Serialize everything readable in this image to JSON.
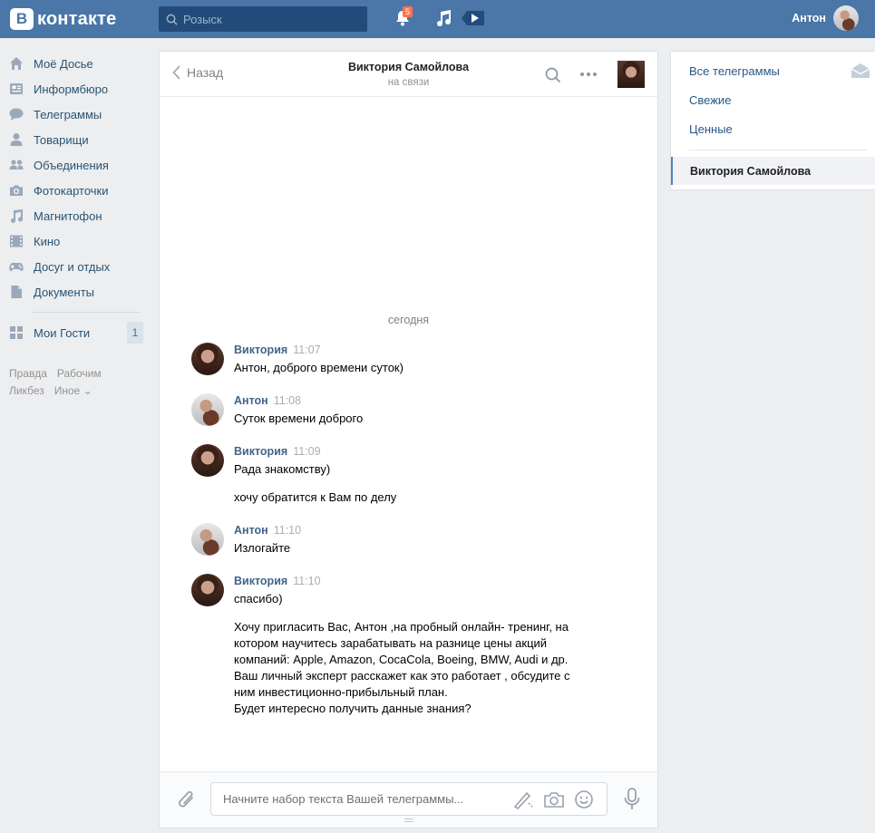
{
  "header": {
    "logo_letter": "В",
    "logo_text": "контакте",
    "search_placeholder": "Розыск",
    "notifications_count": "5",
    "user_name": "Антон"
  },
  "leftnav": {
    "items": [
      {
        "label": "Моё Досье",
        "icon": "home-icon"
      },
      {
        "label": "Информбюро",
        "icon": "news-icon"
      },
      {
        "label": "Телеграммы",
        "icon": "messages-icon"
      },
      {
        "label": "Товарищи",
        "icon": "friends-icon"
      },
      {
        "label": "Объединения",
        "icon": "groups-icon"
      },
      {
        "label": "Фотокарточки",
        "icon": "camera-icon"
      },
      {
        "label": "Магнитофон",
        "icon": "music-icon"
      },
      {
        "label": "Кино",
        "icon": "film-icon"
      },
      {
        "label": "Досуг и отдых",
        "icon": "gamepad-icon"
      },
      {
        "label": "Документы",
        "icon": "document-icon"
      }
    ],
    "guests_label": "Мои Гости",
    "guests_count": "1",
    "footer": [
      "Правда",
      "Рабочим",
      "Ликбез",
      "Иное ⌄"
    ]
  },
  "chat": {
    "back_label": "Назад",
    "peer_name": "Виктория Самойлова",
    "peer_status": "на связи",
    "date_separator": "сегодня",
    "messages": [
      {
        "author": "Виктория",
        "time": "11:07",
        "text": "Антон, доброго времени суток)"
      },
      {
        "author": "Антон",
        "time": "11:08",
        "text": "Суток времени доброго"
      },
      {
        "author": "Виктория",
        "time": "11:09",
        "text": "Рада знакомству)",
        "extra": "хочу обратится к Вам по делу"
      },
      {
        "author": "Антон",
        "time": "11:10",
        "text": "Излогайте"
      },
      {
        "author": "Виктория",
        "time": "11:10",
        "text": "спасибо)",
        "extra_lines": [
          "Хочу пригласить Вас, Антон ,на пробный онлайн- тренинг, на",
          "котором научитесь зарабатывать на разнице цены акций",
          "компаний: Apple, Amazon, CocaCola, Boeing, BMW, Audi и др.",
          "Ваш личный эксперт расскажет как это работает , обсудите с",
          "ним инвестиционно-прибыльный план.",
          "Будет интересно получить данные знания?"
        ]
      }
    ],
    "composer_placeholder": "Начните набор текста Вашей телеграммы..."
  },
  "folders": {
    "all": "Все телеграммы",
    "fresh": "Свежие",
    "valuable": "Ценные",
    "active_conversation": "Виктория Самойлова"
  },
  "colors": {
    "header_bg": "#4a76a8",
    "link": "#2a5885",
    "author": "#42648b",
    "badge": "#ff734c"
  }
}
